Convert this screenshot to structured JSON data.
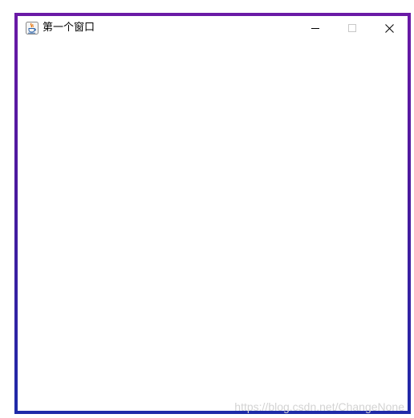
{
  "window": {
    "title": "第一个窗口",
    "icon": "java-cup-icon",
    "controls": {
      "minimize_icon": "minimize-icon",
      "maximize_icon": "maximize-icon",
      "close_icon": "close-icon"
    }
  },
  "watermark": {
    "text": "https://blog.csdn.net/ChangeNone"
  },
  "colors": {
    "frame_top": "#6a1aa6",
    "frame_bottom": "#1f2aa8",
    "edge_accent": "#e8692a",
    "background": "#ffffff"
  }
}
